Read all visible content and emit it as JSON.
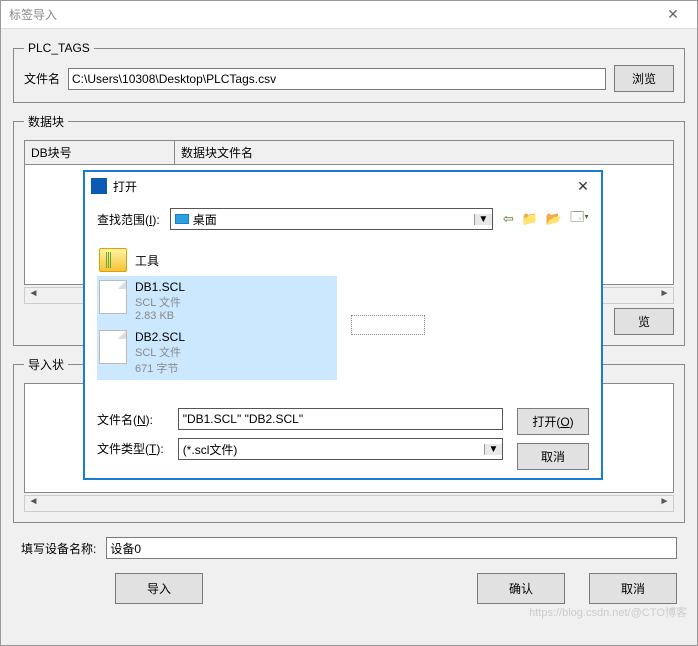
{
  "window": {
    "title": "标签导入",
    "close": "✕"
  },
  "plc_tags": {
    "legend": "PLC_TAGS",
    "filename_label": "文件名",
    "filename_value": "C:\\Users\\10308\\Desktop\\PLCTags.csv",
    "browse_label": "浏览"
  },
  "data_block": {
    "legend": "数据块",
    "col1": "DB块号",
    "col2": "数据块文件名",
    "browse_label": "览"
  },
  "import_status": {
    "legend": "导入状"
  },
  "device": {
    "label": "填写设备名称:",
    "value": "设备0"
  },
  "buttons": {
    "import": "导入",
    "ok": "确认",
    "cancel": "取消"
  },
  "open_dialog": {
    "title": "打开",
    "lookin_label": "查找范围(I):",
    "lookin_value": "桌面",
    "nav": {
      "back": "⇦",
      "up": "📁",
      "new": "📂",
      "view": "🗔▾"
    },
    "folder": {
      "name": "工具"
    },
    "files": [
      {
        "name": "DB1.SCL",
        "type": "SCL 文件",
        "size": "2.83 KB"
      },
      {
        "name": "DB2.SCL",
        "type": "SCL 文件",
        "size": "671 字节"
      }
    ],
    "filename_label": "文件名(N):",
    "filename_value": "\"DB1.SCL\" \"DB2.SCL\"",
    "filetype_label": "文件类型(T):",
    "filetype_value": "(*.scl文件)",
    "open_btn": "打开(O)",
    "cancel_btn": "取消",
    "close": "✕"
  },
  "watermark": "https://blog.csdn.net/@CTО博客"
}
